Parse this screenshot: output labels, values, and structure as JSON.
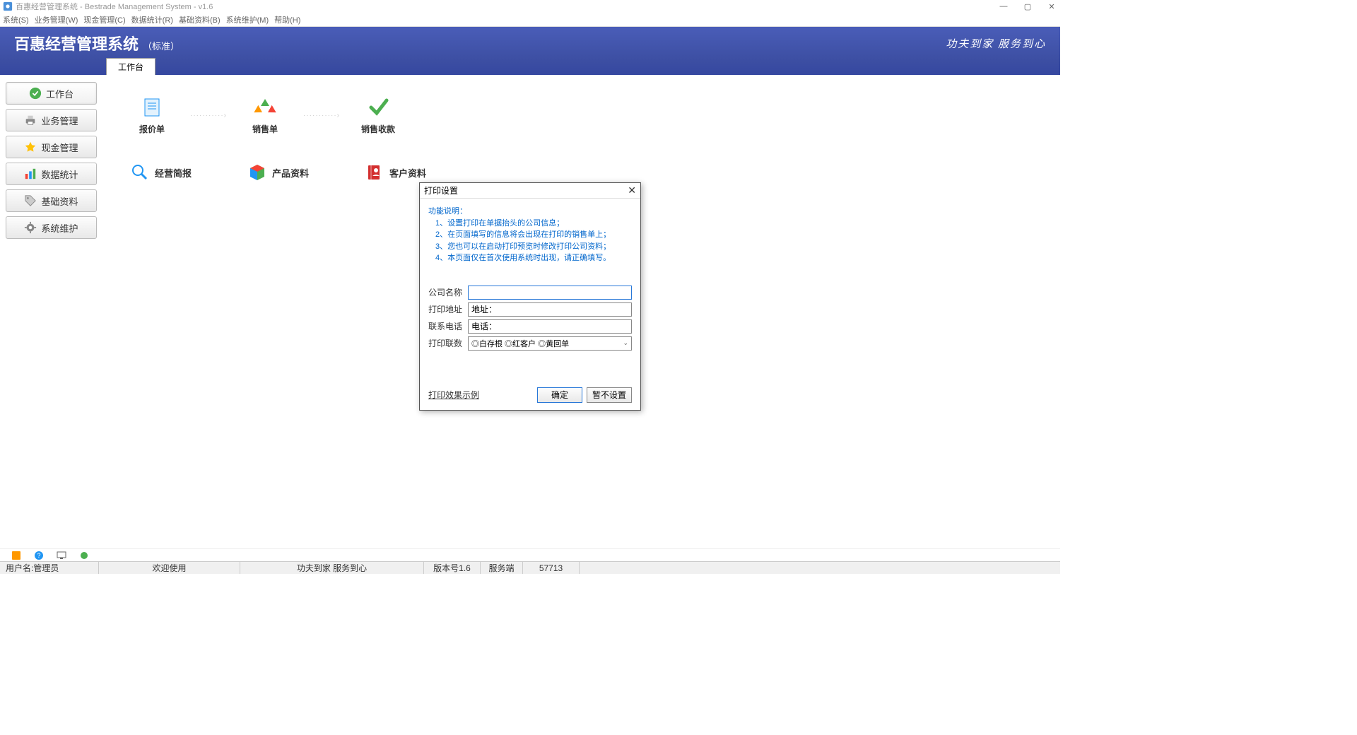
{
  "window": {
    "title": "百惠经营管理系统 - Bestrade Management System - v1.6"
  },
  "menubar": {
    "items": [
      "系统(S)",
      "业务管理(W)",
      "现金管理(C)",
      "数据统计(R)",
      "基础资料(B)",
      "系统维护(M)",
      "帮助(H)"
    ]
  },
  "header": {
    "title": "百惠经营管理系统",
    "subtitle": "（标准）",
    "slogan": "功夫到家 服务到心"
  },
  "tab": {
    "active": "工作台"
  },
  "sidebar": {
    "items": [
      {
        "label": "工作台",
        "icon": "check"
      },
      {
        "label": "业务管理",
        "icon": "printer"
      },
      {
        "label": "现金管理",
        "icon": "star"
      },
      {
        "label": "数据统计",
        "icon": "chart"
      },
      {
        "label": "基础资料",
        "icon": "tag"
      },
      {
        "label": "系统维护",
        "icon": "gear"
      }
    ]
  },
  "workflow": {
    "items": [
      {
        "label": "报价单"
      },
      {
        "label": "销售单"
      },
      {
        "label": "销售收款"
      }
    ]
  },
  "features": {
    "items": [
      {
        "label": "经营简报"
      },
      {
        "label": "产品资料"
      },
      {
        "label": "客户资料"
      }
    ]
  },
  "dialog": {
    "title": "打印设置",
    "desc_title": "功能说明：",
    "desc_lines": [
      "1、设置打印在单据抬头的公司信息；",
      "2、在页面填写的信息将会出现在打印的销售单上；",
      "3、您也可以在启动打印预览时修改打印公司资料；",
      "4、本页面仅在首次使用系统时出现，请正确填写。"
    ],
    "form": {
      "company_label": "公司名称",
      "company_value": "",
      "address_label": "打印地址",
      "address_value": "地址：",
      "phone_label": "联系电话",
      "phone_value": "电话：",
      "copies_label": "打印联数",
      "copies_value": "◎白存根 ◎红客户 ◎黄回单"
    },
    "link": "打印效果示例",
    "ok_button": "确定",
    "cancel_button": "暂不设置"
  },
  "statusbar": {
    "user_label": "用户名:管理员",
    "welcome": "欢迎使用",
    "motto": "功夫到家 服务到心",
    "version": "版本号1.6",
    "server": "服务端",
    "port": "57713"
  }
}
